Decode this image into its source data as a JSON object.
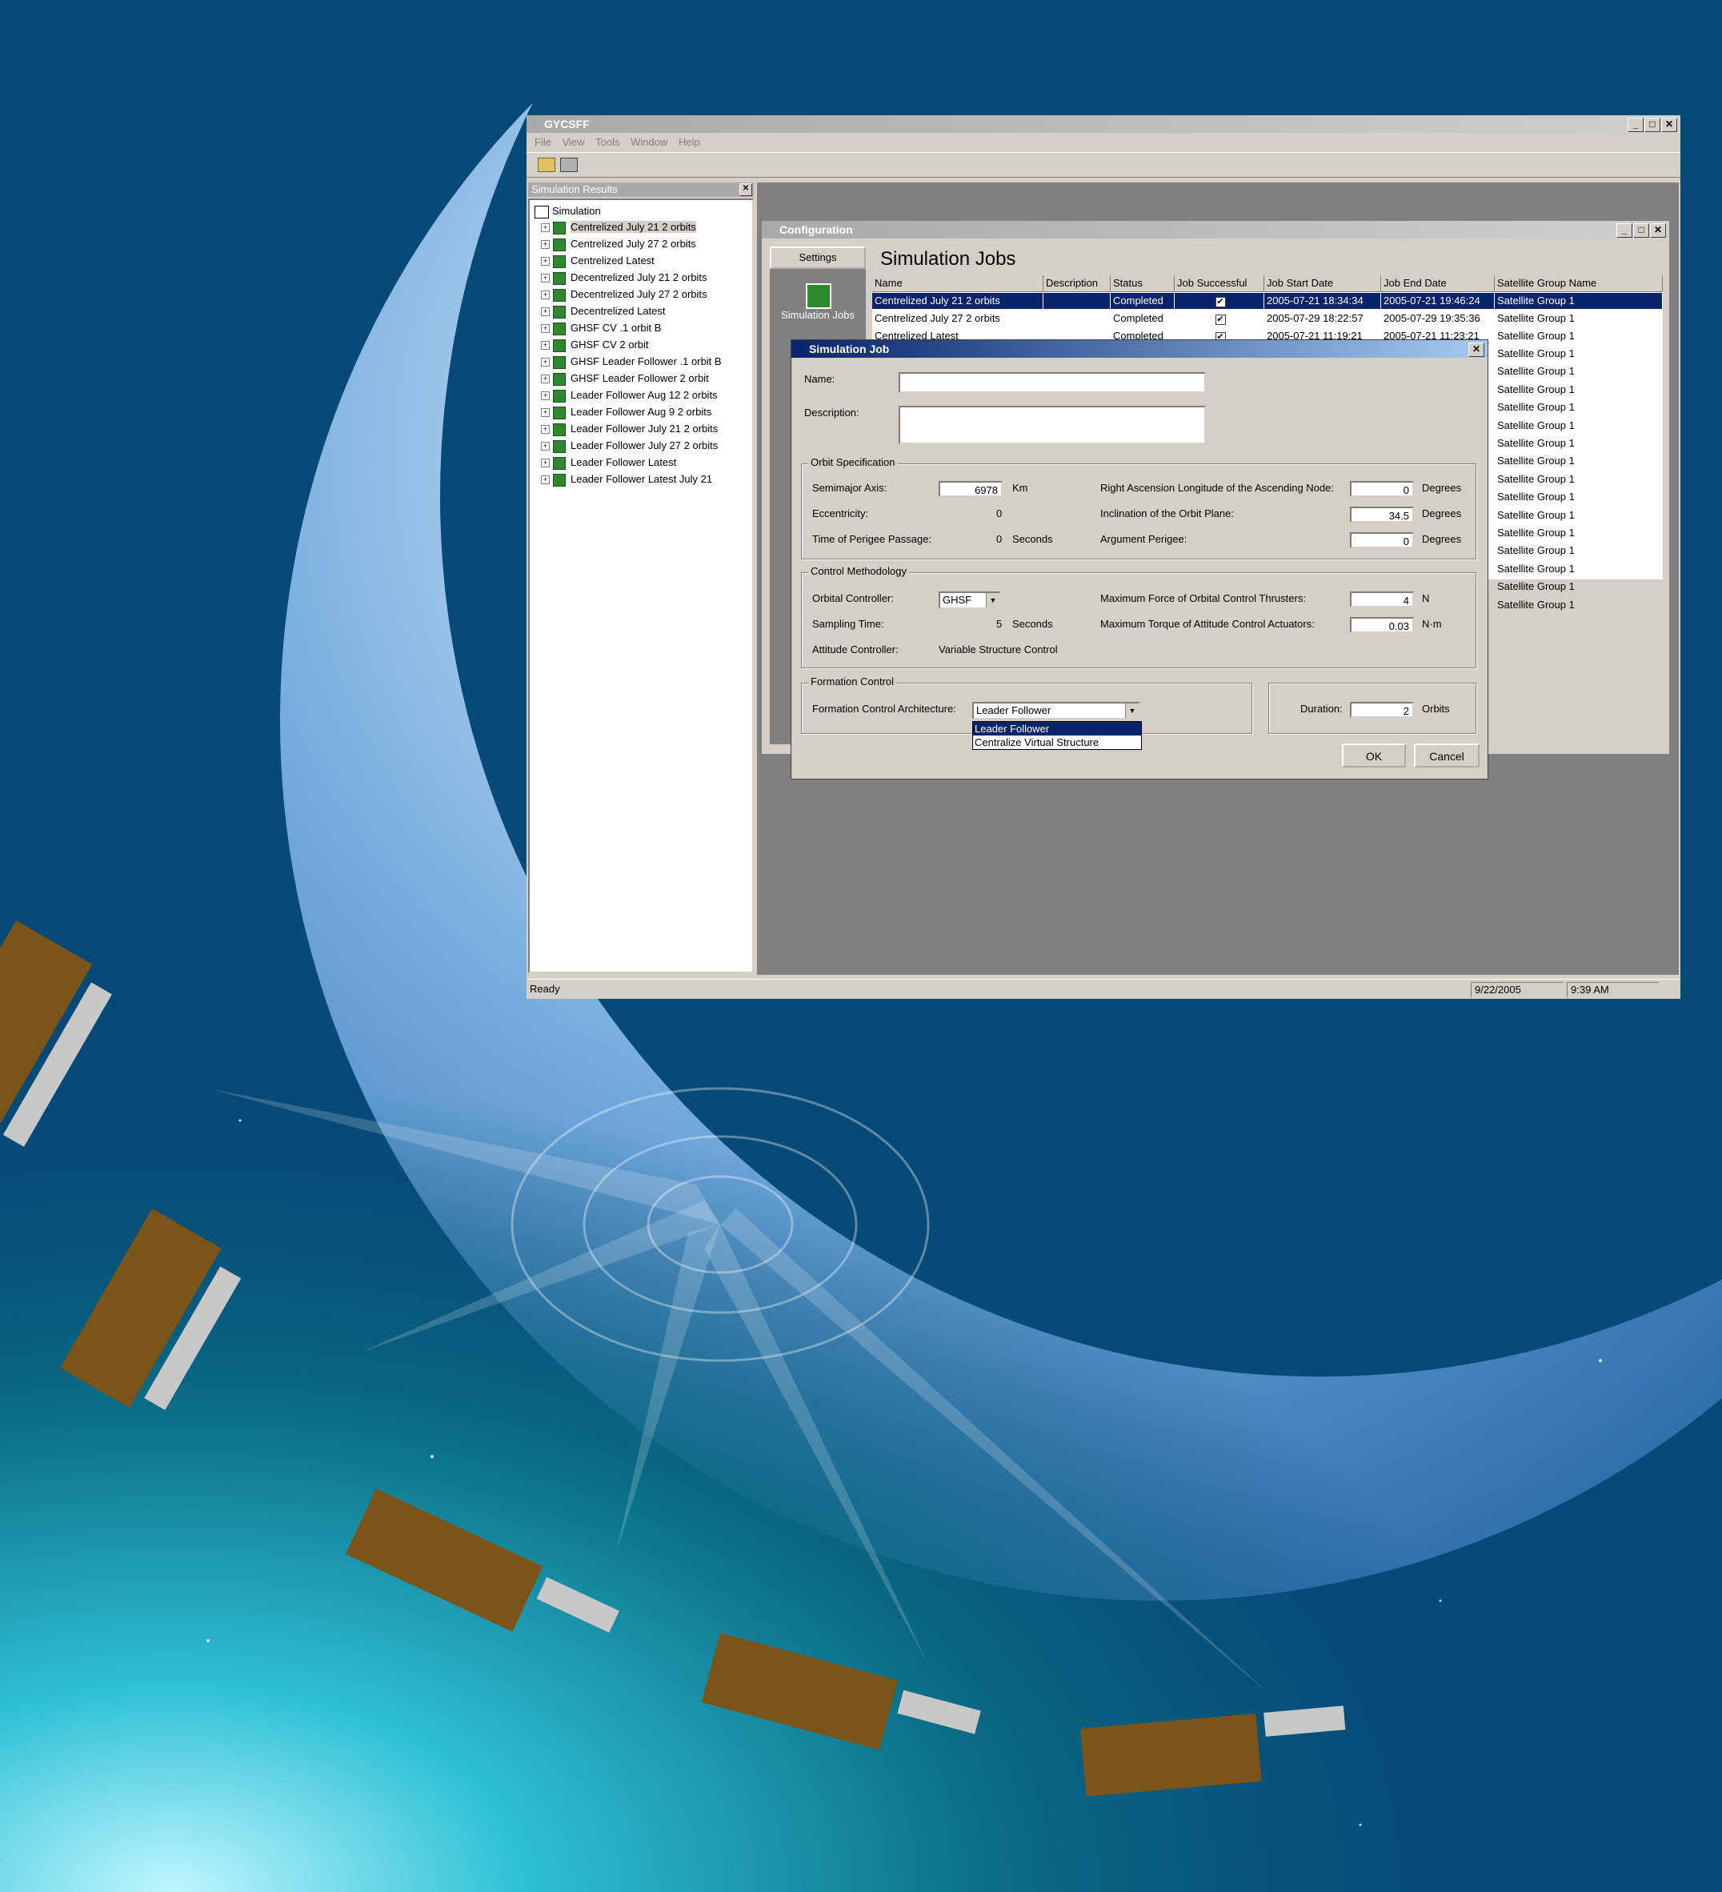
{
  "app": {
    "title": "GYCSFF",
    "menu": [
      "File",
      "View",
      "Tools",
      "Window",
      "Help"
    ],
    "toolbar_icons": [
      "open-folder-icon",
      "print-icon"
    ]
  },
  "results_panel": {
    "title": "Simulation Results",
    "root": "Simulation",
    "items": [
      "Centrelized  July 21 2 orbits",
      "Centrelized July 27 2 orbits",
      "Centrelized Latest",
      "Decentrelized   July 21 2 orbits",
      "Decentrelized   July 27 2 orbits",
      "Decentrelized  Latest",
      "GHSF CV .1 orbit  B",
      "GHSF CV 2 orbit",
      "GHSF Leader Follower .1 orbit B",
      "GHSF Leader Follower 2 orbit",
      "Leader Follower Aug 12 2 orbits",
      "Leader Follower Aug 9 2 orbits",
      "Leader Follower July 21 2 orbits",
      "Leader Follower July 27 2 orbits",
      "Leader Follower Latest",
      "Leader Follower Latest July 21"
    ]
  },
  "config": {
    "title": "Configuration",
    "side_buttons": [
      "Settings",
      "Simulation Jobs"
    ],
    "heading": "Simulation Jobs",
    "columns": [
      "Name",
      "Description",
      "Status",
      "Job Successful",
      "Job Start Date",
      "Job End Date",
      "Satellite Group Name"
    ],
    "rows": [
      {
        "name": "Centrelized  July 21 2 orbits",
        "description": "",
        "status": "Completed",
        "ok": "✔",
        "start": "2005-07-21 18:34:34",
        "end": "2005-07-21 19:46:24",
        "group": "Satellite Group 1"
      },
      {
        "name": "Centrelized July 27 2 orbits",
        "description": "",
        "status": "Completed",
        "ok": "✔",
        "start": "2005-07-29 18:22:57",
        "end": "2005-07-29 19:35:36",
        "group": "Satellite Group 1"
      },
      {
        "name": "Centrelized Latest",
        "description": "",
        "status": "Completed",
        "ok": "✔",
        "start": "2005-07-21 11:19:21",
        "end": "2005-07-21 11:23:21",
        "group": "Satellite Group 1"
      }
    ],
    "group_column_more": [
      "Satellite Group 1",
      "Satellite Group 1",
      "Satellite Group 1",
      "Satellite Group 1",
      "Satellite Group 1",
      "Satellite Group 1",
      "Satellite Group 1",
      "Satellite Group 1",
      "Satellite Group 1",
      "Satellite Group 1",
      "Satellite Group 1",
      "Satellite Group 1",
      "Satellite Group 1",
      "Satellite Group 1",
      "Satellite Group 1"
    ]
  },
  "job": {
    "title": "Simulation Job",
    "name_label": "Name:",
    "name_value": "",
    "description_label": "Description:",
    "description_value": "",
    "orbit": {
      "title": "Orbit Specification",
      "semimajor_label": "Semimajor Axis:",
      "semimajor_value": "6978",
      "semimajor_unit": "Km",
      "ecc_label": "Eccentricity:",
      "ecc_value": "0",
      "perigee_time_label": "Time of Perigee Passage:",
      "perigee_time_value": "0",
      "perigee_time_unit": "Seconds",
      "raan_label": "Right Ascension Longitude of the Ascending Node:",
      "raan_value": "0",
      "raan_unit": "Degrees",
      "incl_label": "Inclination of the Orbit Plane:",
      "incl_value": "34.5",
      "incl_unit": "Degrees",
      "argp_label": "Argument Perigee:",
      "argp_value": "0",
      "argp_unit": "Degrees"
    },
    "control": {
      "title": "Control Methodology",
      "orbital_label": "Orbital Controller:",
      "orbital_value": "GHSF",
      "sampling_label": "Sampling Time:",
      "sampling_value": "5",
      "sampling_unit": "Seconds",
      "attitude_label": "Attitude Controller:",
      "attitude_value": "Variable Structure Control",
      "force_label": "Maximum Force of Orbital Control Thrusters:",
      "force_value": "4",
      "force_unit": "N",
      "torque_label": "Maximum Torque of Attitude Control Actuators:",
      "torque_value": "0.03",
      "torque_unit": "N·m"
    },
    "formation": {
      "title": "Formation Control",
      "arch_label": "Formation Control Architecture:",
      "arch_value": "Leader Follower",
      "options": [
        "Leader Follower",
        "Centralize Virtual Structure"
      ],
      "duration_label": "Duration:",
      "duration_value": "2",
      "duration_unit": "Orbits"
    },
    "ok": "OK",
    "cancel": "Cancel"
  },
  "status": {
    "text": "Ready",
    "date": "9/22/2005",
    "time": "9:39 AM"
  }
}
